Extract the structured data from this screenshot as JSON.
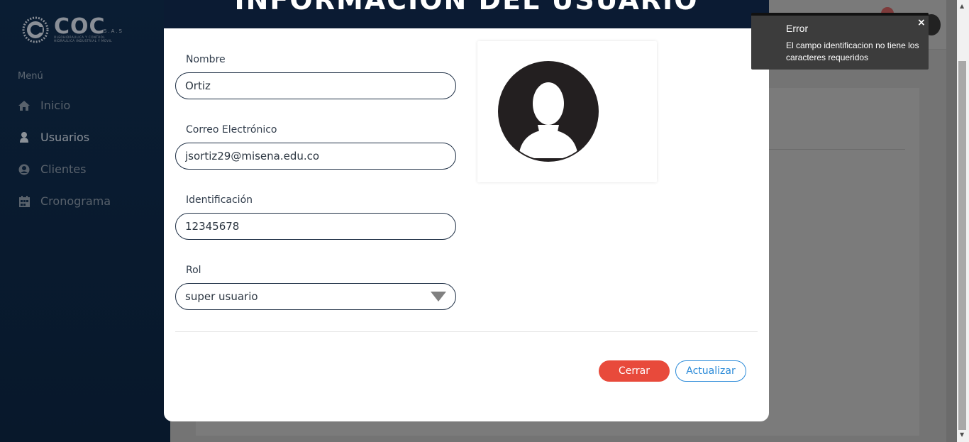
{
  "sidebar": {
    "logo_text": "COC",
    "logo_sas": "S.A.S",
    "logo_sub1": "OLEOHIDRAULICA Y CONTROL",
    "logo_sub2": "HIDRAULICA INDUSTRIAL Y MOVIL",
    "menu_label": "Menú",
    "items": [
      {
        "label": "Inicio",
        "icon": "home-icon"
      },
      {
        "label": "Usuarios",
        "icon": "user-icon"
      },
      {
        "label": "Clientes",
        "icon": "user-circle-icon"
      },
      {
        "label": "Cronograma",
        "icon": "calendar-icon"
      }
    ]
  },
  "modal": {
    "title": "INFORMACIÓN DEL USUARIO",
    "fields": {
      "nombre_label": "Nombre",
      "nombre_value": "Ortiz",
      "correo_label": "Correo Electrónico",
      "correo_value": "jsortiz29@misena.edu.co",
      "identificacion_label": "Identificación",
      "identificacion_value": "12345678",
      "rol_label": "Rol",
      "rol_value": "super usuario"
    },
    "buttons": {
      "close_label": "Cerrar",
      "update_label": "Actualizar"
    }
  },
  "toast": {
    "title": "Error",
    "message": "El campo identificacion no tiene los caracteres requeridos",
    "close": "×"
  },
  "colors": {
    "sidebar": "#0a1d33",
    "modal_header": "#0b1b33",
    "close_button": "#e84a3b",
    "update_button": "#2a8ad8"
  }
}
